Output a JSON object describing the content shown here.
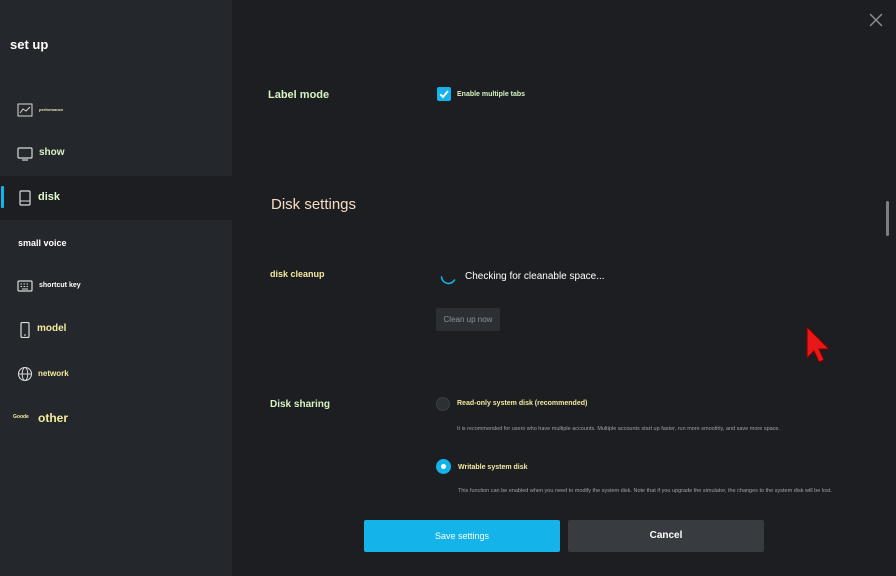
{
  "sidebar": {
    "title": "set up",
    "items": [
      {
        "label": "performance",
        "icon": "chart-icon"
      },
      {
        "label": "show",
        "icon": "monitor-icon"
      },
      {
        "label": "disk",
        "icon": "disk-icon"
      },
      {
        "label": "small voice",
        "icon": ""
      },
      {
        "label": "shortcut key",
        "icon": "keyboard-icon"
      },
      {
        "label": "model",
        "icon": "phone-icon"
      },
      {
        "label": "network",
        "icon": "globe-icon"
      },
      {
        "label": "other",
        "icon_text": "Goode"
      }
    ],
    "active_index": 2
  },
  "main": {
    "label_mode": {
      "label": "Label mode",
      "checkbox_label": "Enable multiple tabs",
      "checked": true
    },
    "section_title": "Disk settings",
    "disk_cleanup": {
      "label": "disk cleanup",
      "status": "Checking for cleanable space...",
      "button": "Clean up now"
    },
    "disk_sharing": {
      "label": "Disk sharing",
      "options": [
        {
          "label": "Read-only system disk (recommended)",
          "description": "It is recommended for users who have multiple accounts. Multiple accounts start up faster, run more smoothly, and save more space.",
          "selected": false
        },
        {
          "label": "Writable system disk",
          "description": "This function can be enabled when you need to modify the system disk. Note that if you upgrade the simulator, the changes to the system disk will be lost.",
          "selected": true
        }
      ]
    },
    "footer": {
      "save": "Save settings",
      "cancel": "Cancel"
    }
  },
  "colors": {
    "accent": "#14b4ea",
    "background": "#1c1e21",
    "sidebar": "#24272b",
    "label_yellow": "#f4eba0",
    "label_green": "#d8f3c2",
    "section_title": "#f6dcc4"
  }
}
